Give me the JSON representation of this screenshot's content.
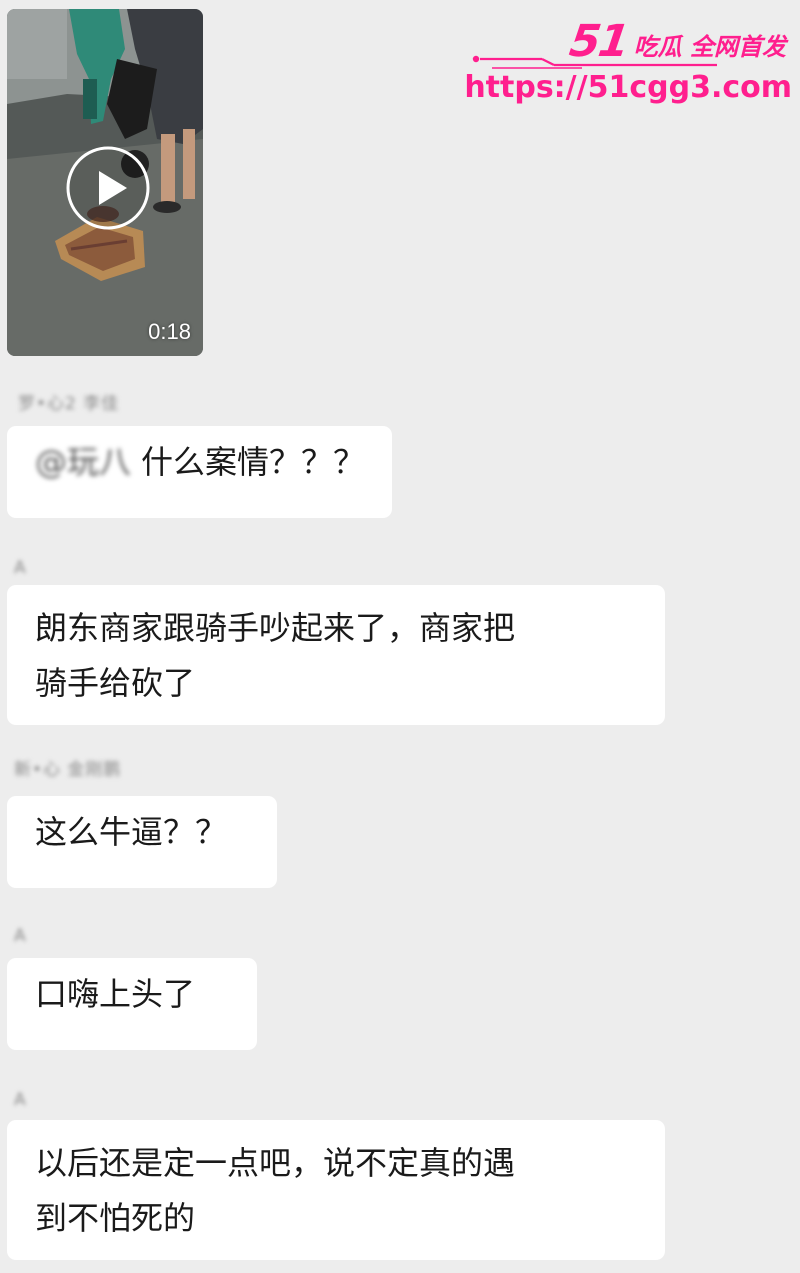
{
  "watermark": {
    "brand_number": "51",
    "slogan": "吃瓜 全网首发",
    "url": "https://51cgg3.com",
    "color": "#ff1f8e"
  },
  "video": {
    "duration": "0:18",
    "icon": "play-icon"
  },
  "messages": [
    {
      "sender": "罗•心2 李佳",
      "mention": "@玩八",
      "lines": [
        "什么案情？？？"
      ]
    },
    {
      "sender": "A",
      "lines": [
        "朗东商家跟骑手吵起来了，商家把",
        "骑手给砍了"
      ]
    },
    {
      "sender": "新•心 金刚鹏",
      "lines": [
        "这么牛逼？？"
      ]
    },
    {
      "sender": "A",
      "lines": [
        "口嗨上头了"
      ]
    },
    {
      "sender": "A",
      "lines": [
        "以后还是定一点吧，说不定真的遇",
        "到不怕死的"
      ]
    }
  ],
  "colors": {
    "background": "#ededed",
    "bubble": "#ffffff",
    "text": "#1a1a1a"
  }
}
